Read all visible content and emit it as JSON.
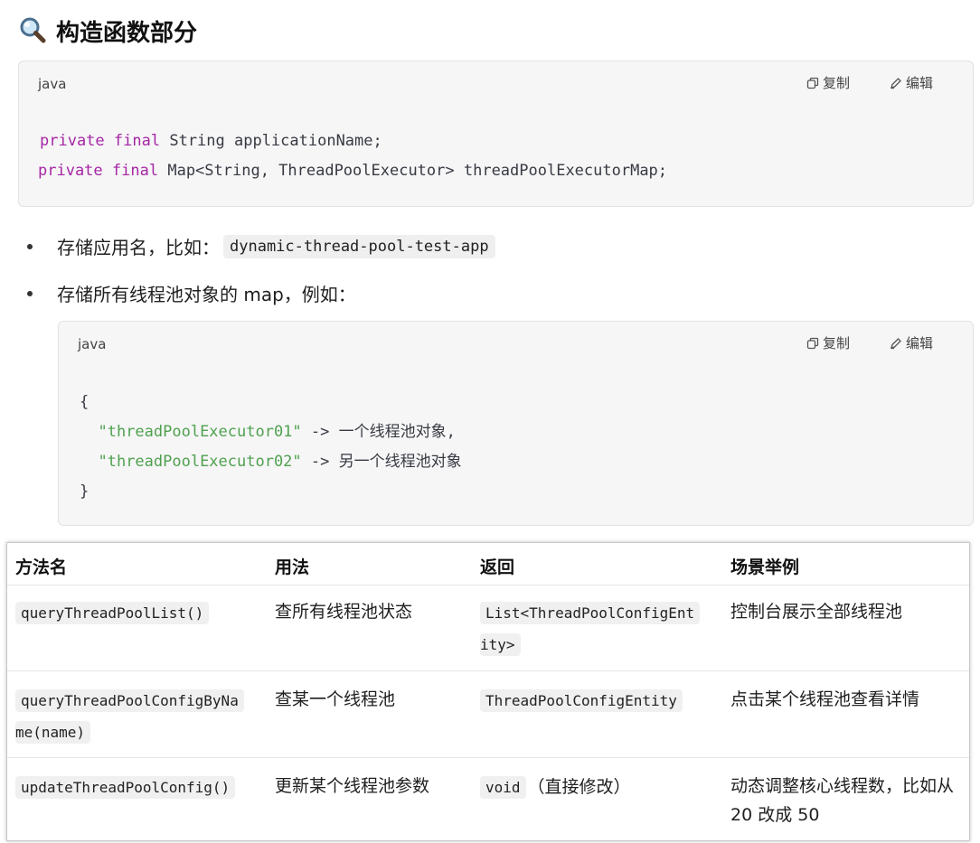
{
  "heading": {
    "icon": "magnifier-icon",
    "title": "构造函数部分"
  },
  "code_block_1": {
    "lang": "java",
    "copy_label": "复制",
    "edit_label": "编辑",
    "line1": {
      "kw1": "private",
      "kw2": "final",
      "rest": "String applicationName;"
    },
    "line2": {
      "kw1": "private",
      "kw2": "final",
      "rest": "Map<String, ThreadPoolExecutor> threadPoolExecutorMap;"
    }
  },
  "bullets": [
    {
      "text": "存储应用名，比如：",
      "code": "dynamic-thread-pool-test-app"
    },
    {
      "text": "存储所有线程池对象的 map，例如："
    }
  ],
  "code_block_2": {
    "lang": "java",
    "copy_label": "复制",
    "edit_label": "编辑",
    "open": "{",
    "entry1_key": "\"threadPoolExecutor01\"",
    "entry1_rest": " -> 一个线程池对象,",
    "entry2_key": "\"threadPoolExecutor02\"",
    "entry2_rest": " -> 另一个线程池对象",
    "close": "}"
  },
  "table": {
    "headers": [
      "方法名",
      "用法",
      "返回",
      "场景举例"
    ],
    "rows": [
      {
        "method_l1": "queryThreadPoolList()",
        "usage": "查所有线程池状态",
        "ret_l1": "List<ThreadPoolConfigEnt",
        "ret_l2": "ity>",
        "scene_l1": "控制台展示全部线程池"
      },
      {
        "method_l1": "queryThreadPoolConfigByNa",
        "method_l2": "me(name)",
        "usage": "查某一个线程池",
        "ret_l1": "ThreadPoolConfigEntity",
        "scene_l1": "点击某个线程池查看详情"
      },
      {
        "method_l1": "updateThreadPoolConfig()",
        "usage": "更新某个线程池参数",
        "ret_code": "void",
        "ret_text": "（直接修改）",
        "scene_l1": "动态调整核心线程数，比如从",
        "scene_l2": "20 改成 50"
      }
    ]
  }
}
